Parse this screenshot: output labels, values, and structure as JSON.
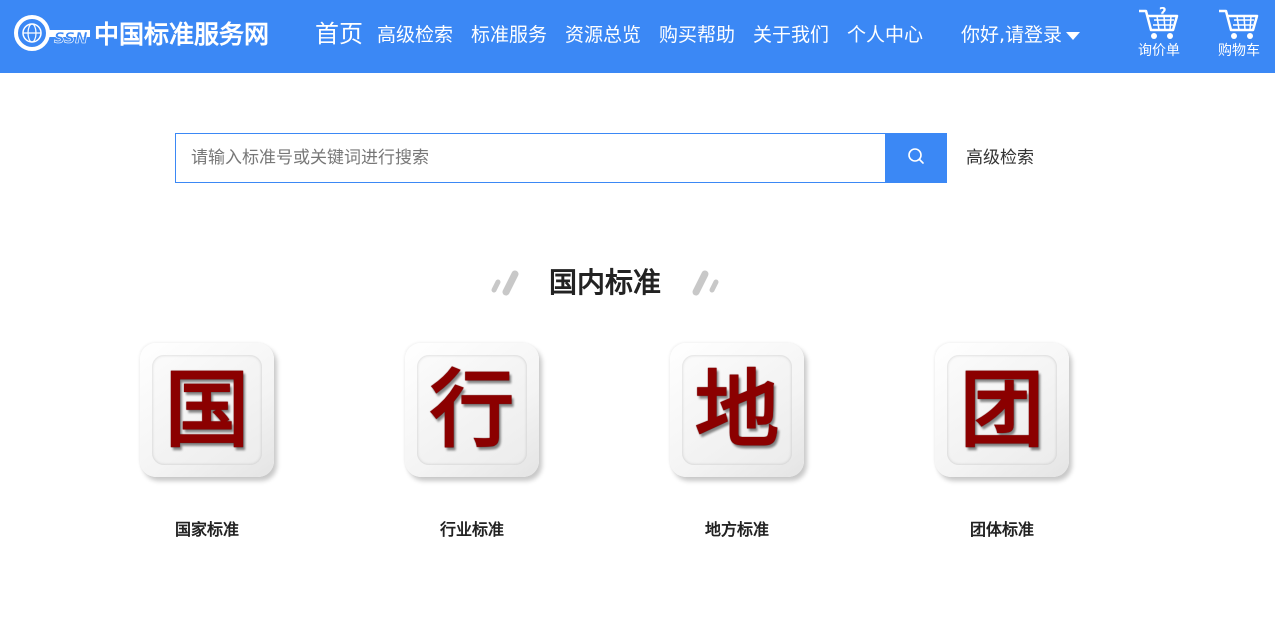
{
  "header": {
    "logo_text": "中国标准服务网",
    "logo_mark_text": "SSN",
    "nav": [
      {
        "label": "首页"
      },
      {
        "label": "高级检索"
      },
      {
        "label": "标准服务"
      },
      {
        "label": "资源总览"
      },
      {
        "label": "购买帮助"
      },
      {
        "label": "关于我们"
      },
      {
        "label": "个人中心"
      }
    ],
    "login_label": "你好,请登录",
    "inquiry_label": "询价单",
    "cart_label": "购物车"
  },
  "search": {
    "placeholder": "请输入标准号或关键词进行搜索",
    "advanced_label": "高级检索"
  },
  "section": {
    "title": "国内标准",
    "tiles": [
      {
        "char": "国",
        "label": "国家标准"
      },
      {
        "char": "行",
        "label": "行业标准"
      },
      {
        "char": "地",
        "label": "地方标准"
      },
      {
        "char": "团",
        "label": "团体标准"
      }
    ]
  },
  "colors": {
    "header_bg": "#3b88f5",
    "tile_char": "#8b0000"
  },
  "icons": [
    "ssn-logo-icon",
    "search-icon",
    "inquiry-cart-icon",
    "shopping-cart-icon",
    "caret-down-icon"
  ]
}
